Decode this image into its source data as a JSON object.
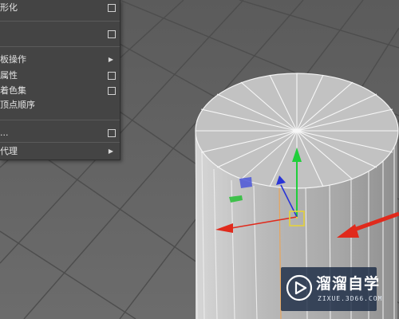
{
  "context_menu": {
    "items": [
      {
        "label": "形化",
        "has_option_box": true,
        "has_submenu": false
      },
      {
        "label": "",
        "has_option_box": true,
        "has_submenu": false
      },
      {
        "label": "板操作",
        "has_option_box": false,
        "has_submenu": true
      },
      {
        "label": "属性",
        "has_option_box": true,
        "has_submenu": false
      },
      {
        "label": "着色集",
        "has_option_box": true,
        "has_submenu": false
      },
      {
        "label": "顶点顺序",
        "has_option_box": false,
        "has_submenu": false
      },
      {
        "label": "...",
        "has_option_box": true,
        "has_submenu": false
      },
      {
        "label": "代理",
        "has_option_box": false,
        "has_submenu": true
      }
    ]
  },
  "viewport": {
    "object": "cylinder",
    "manipulator": "move-tool"
  },
  "watermark": {
    "brand": "溜溜自学",
    "site": "ZIXUE.3D66.COM"
  },
  "colors": {
    "menu_bg": "#444444",
    "viewport_bg": "#646464",
    "grid_line": "#4e4e4e",
    "cylinder_face": "#b8b8b8",
    "axis_x": "#e02a1c",
    "axis_y": "#1fcf3a",
    "axis_z": "#2a35d6",
    "pivot": "#e6d23a",
    "watermark_bg": "#1c2c46"
  }
}
